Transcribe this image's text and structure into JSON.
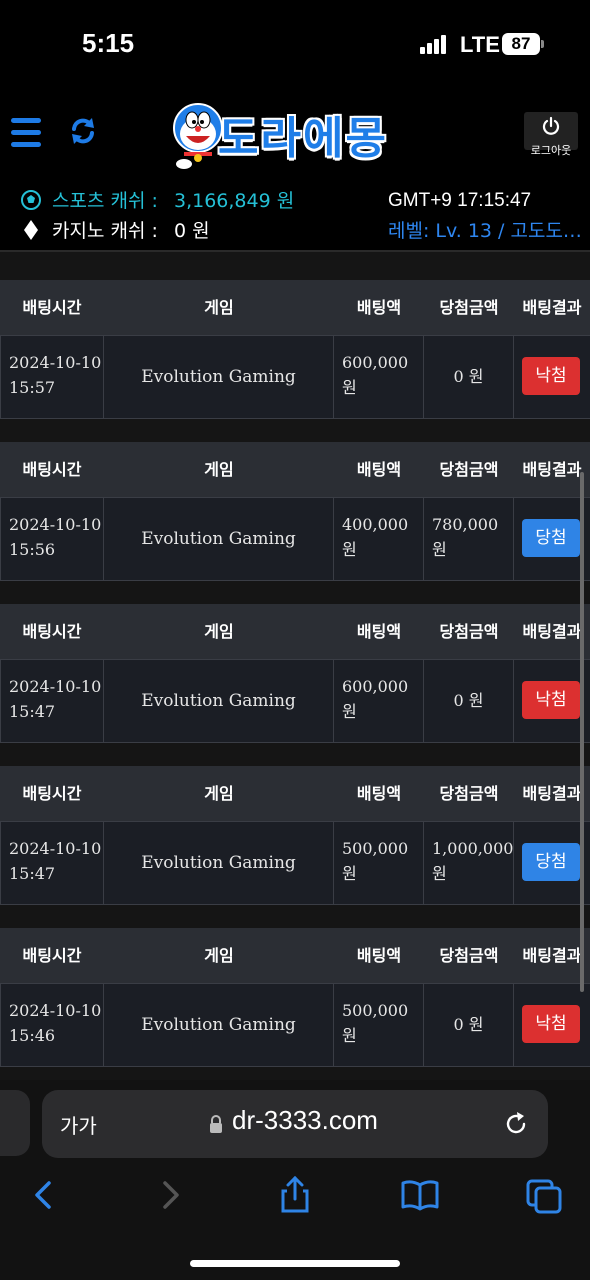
{
  "status_bar": {
    "time": "5:15",
    "network": "LTE",
    "battery": "87"
  },
  "header": {
    "logo_text": "도라에몽",
    "logout_label": "로그아웃",
    "sports_label": "스포츠 캐쉬 :",
    "sports_value": "3,166,849 원",
    "casino_label": "카지노 캐쉬 :",
    "casino_value": "0 원",
    "gmt": "GMT+9 17:15:47",
    "level": "레벨: Lv. 13 / 고도도…"
  },
  "table_headers": [
    "배팅시간",
    "게임",
    "배팅액",
    "당첨금액",
    "배팅결과"
  ],
  "bets": [
    {
      "date": "2024-10-10",
      "time": "15:57",
      "game": "Evolution Gaming",
      "bet": "600,000",
      "bet_unit": "원",
      "win": "0 원",
      "win_unit": "",
      "result": "낙첨",
      "result_type": "lose"
    },
    {
      "date": "2024-10-10",
      "time": "15:56",
      "game": "Evolution Gaming",
      "bet": "400,000",
      "bet_unit": "원",
      "win": "780,000",
      "win_unit": "원",
      "result": "당첨",
      "result_type": "win"
    },
    {
      "date": "2024-10-10",
      "time": "15:47",
      "game": "Evolution Gaming",
      "bet": "600,000",
      "bet_unit": "원",
      "win": "0 원",
      "win_unit": "",
      "result": "낙첨",
      "result_type": "lose"
    },
    {
      "date": "2024-10-10",
      "time": "15:47",
      "game": "Evolution Gaming",
      "bet": "500,000",
      "bet_unit": "원",
      "win": "1,000,000",
      "win_unit": "원",
      "result": "당첨",
      "result_type": "win"
    },
    {
      "date": "2024-10-10",
      "time": "15:46",
      "game": "Evolution Gaming",
      "bet": "500,000",
      "bet_unit": "원",
      "win": "0 원",
      "win_unit": "",
      "result": "낙첨",
      "result_type": "lose"
    }
  ],
  "browser": {
    "aa_label": "가가",
    "url": "dr-3333.com"
  },
  "colors": {
    "accent": "#1f7ee8",
    "lose": "#dc3030",
    "win": "#2f84e6",
    "sports": "#25c0d6"
  }
}
